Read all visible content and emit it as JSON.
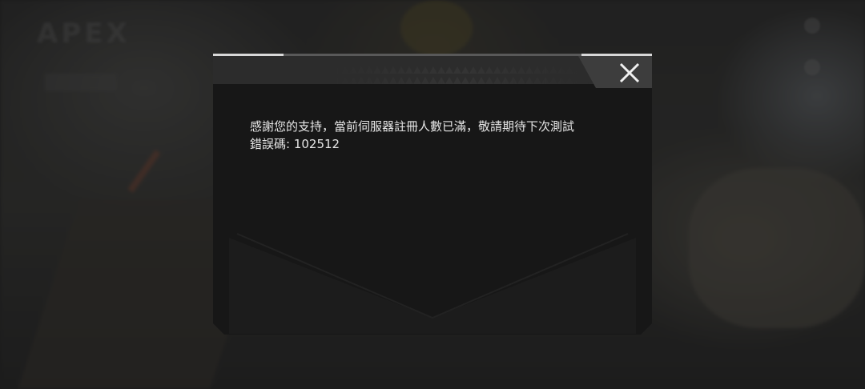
{
  "dialog": {
    "message": "感謝您的支持，當前伺服器註冊人數已滿，敬請期待下次測試",
    "error_label": "錯誤碼:",
    "error_code": "102512"
  },
  "background": {
    "logo_text": "APEX"
  },
  "colors": {
    "dialog_bg": "#171717",
    "header_bg": "#2c2c2c",
    "text": "#e6e6e6",
    "accent_line": "#d8d8d8"
  },
  "icons": {
    "close": "close-x-icon"
  }
}
